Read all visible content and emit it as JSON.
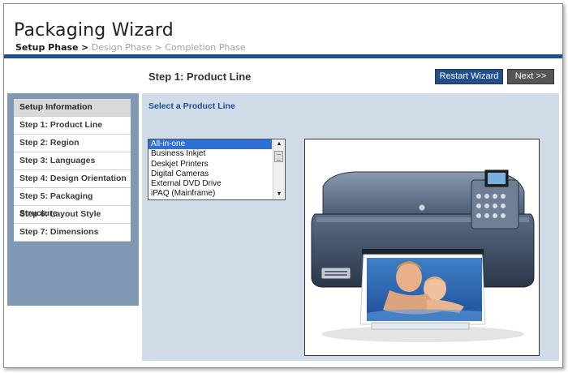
{
  "app": {
    "title": "Packaging Wizard",
    "phases": [
      "Setup Phase",
      "Design Phase",
      "Completion Phase"
    ],
    "phase_separator": ">"
  },
  "toolbar": {
    "step_title": "Step 1: Product Line",
    "restart_label": "Restart Wizard",
    "next_label": "Next >>"
  },
  "sidebar": {
    "items": [
      {
        "label": "Setup Information"
      },
      {
        "label": "Step 1: Product Line"
      },
      {
        "label": "Step 2: Region"
      },
      {
        "label": "Step 3: Languages"
      },
      {
        "label": "Step 4: Design Orientation"
      },
      {
        "label": "Step 5: Packaging Structure"
      },
      {
        "label": "Step 6: Layout Style"
      },
      {
        "label": "Step 7: Dimensions"
      }
    ]
  },
  "main": {
    "select_label": "Select a Product Line",
    "options": [
      "All-in-one",
      "Business Inkjet",
      "Deskjet Printers",
      "Digital Cameras",
      "External DVD Drive",
      "iPAQ (Mainframe)"
    ],
    "selected_option": "All-in-one"
  },
  "colors": {
    "brand_blue": "#1f4f8f",
    "sidebar_bg": "#7f98b3",
    "main_bg": "#cfdce8",
    "selection": "#2f6fd6"
  }
}
